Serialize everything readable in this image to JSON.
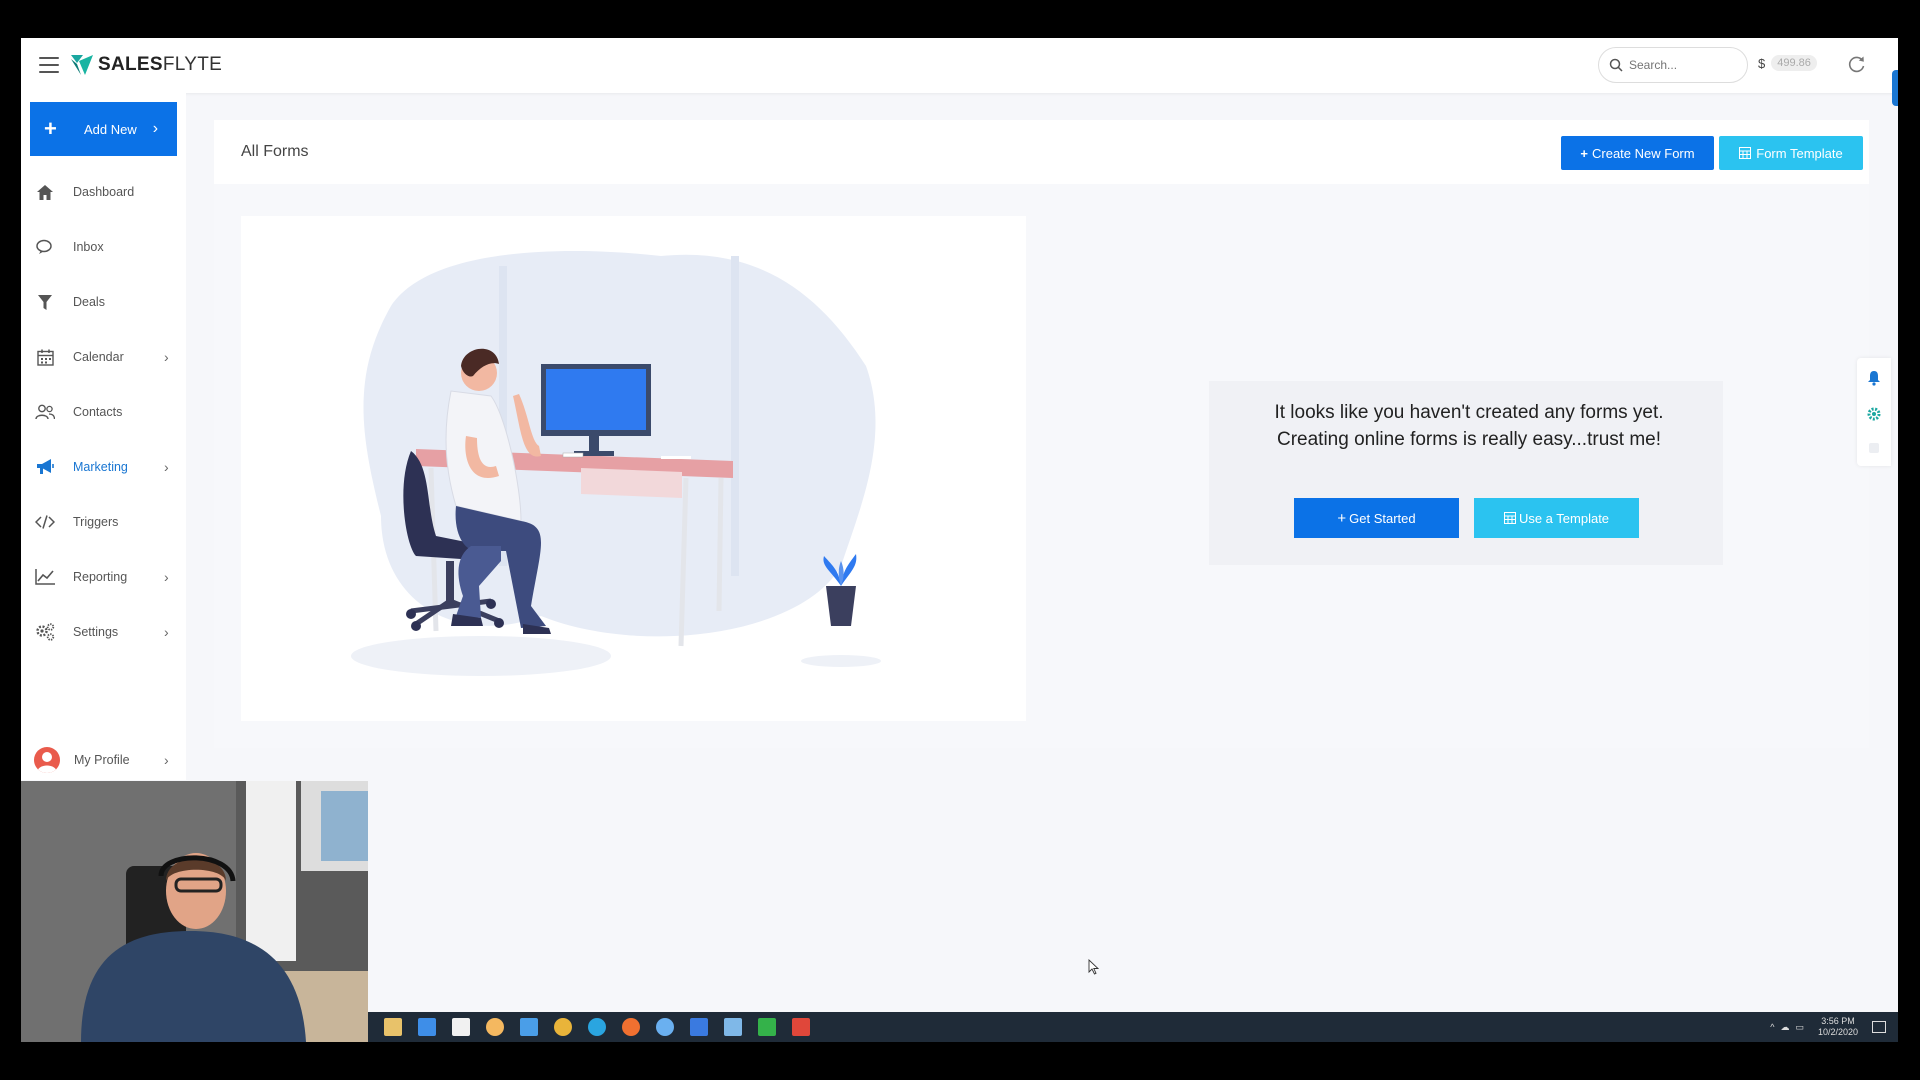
{
  "app": {
    "logo_bold": "SALES",
    "logo_rest": "FLYTE"
  },
  "topbar": {
    "search_placeholder": "Search...",
    "currency": "$",
    "balance": "499.86",
    "icons": [
      "hamburger-icon",
      "search-icon",
      "refresh-icon"
    ]
  },
  "sidebar": {
    "add_new_label": "Add New",
    "items": [
      {
        "label": "Dashboard",
        "icon": "home-icon",
        "has_submenu": false
      },
      {
        "label": "Inbox",
        "icon": "chat-icon",
        "has_submenu": false
      },
      {
        "label": "Deals",
        "icon": "filter-icon",
        "has_submenu": false
      },
      {
        "label": "Calendar",
        "icon": "calendar-icon",
        "has_submenu": true
      },
      {
        "label": "Contacts",
        "icon": "users-icon",
        "has_submenu": false
      },
      {
        "label": "Marketing",
        "icon": "megaphone-icon",
        "has_submenu": true,
        "active": true
      },
      {
        "label": "Triggers",
        "icon": "code-icon",
        "has_submenu": false
      },
      {
        "label": "Reporting",
        "icon": "chart-icon",
        "has_submenu": true
      },
      {
        "label": "Settings",
        "icon": "gears-icon",
        "has_submenu": true
      }
    ],
    "profile_label": "My Profile"
  },
  "main": {
    "title": "All Forms",
    "create_button": "Create New Form",
    "template_button": "Form Template",
    "empty_message": "It looks like you haven't created any forms yet. Creating online forms is really easy...trust me!",
    "get_started_button": "Get Started",
    "use_template_button": "Use a Template"
  },
  "taskbar": {
    "time": "3:56 PM",
    "date": "10/2/2020"
  },
  "colors": {
    "primary": "#0b72e7",
    "secondary": "#2bc3f0",
    "active_nav": "#1976d2",
    "taskbar": "#1f2b38"
  }
}
